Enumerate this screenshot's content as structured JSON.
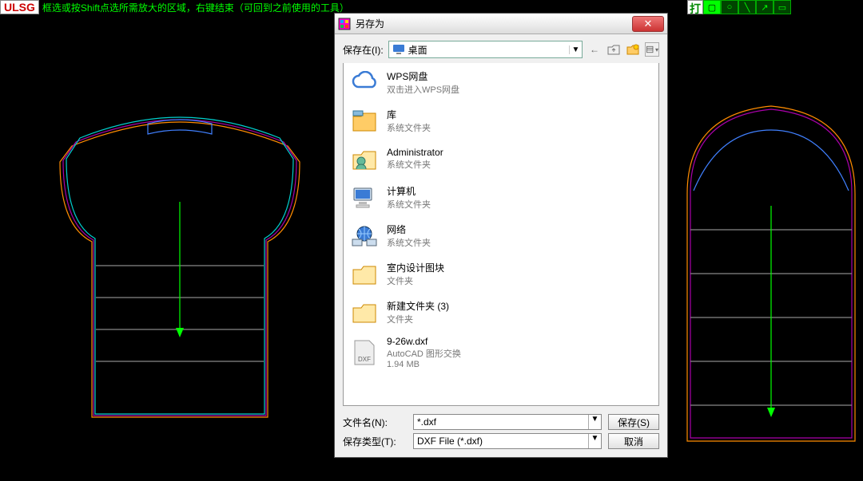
{
  "brand": "ULSG",
  "hint_text": "框选或按Shift点选所需放大的区域，右键结束（可回到之前使用的工具）",
  "tool_label": "打",
  "dialog": {
    "title": "另存为",
    "save_in_label": "保存在(I):",
    "save_in_value": "桌面",
    "items": [
      {
        "name": "WPS网盘",
        "sub": "双击进入WPS网盘",
        "kind": "wps"
      },
      {
        "name": "库",
        "sub": "系统文件夹",
        "kind": "lib"
      },
      {
        "name": "Administrator",
        "sub": "系统文件夹",
        "kind": "user"
      },
      {
        "name": "计算机",
        "sub": "系统文件夹",
        "kind": "computer"
      },
      {
        "name": "网络",
        "sub": "系统文件夹",
        "kind": "network"
      },
      {
        "name": "室内设计图块",
        "sub": "文件夹",
        "kind": "folder"
      },
      {
        "name": "新建文件夹 (3)",
        "sub": "文件夹",
        "kind": "folder"
      },
      {
        "name": "9-26w.dxf",
        "sub": "AutoCAD 图形交换",
        "size": "1.94 MB",
        "kind": "dxf"
      }
    ],
    "filename_label": "文件名(N):",
    "filename_value": "*.dxf",
    "filetype_label": "保存类型(T):",
    "filetype_value": "DXF File (*.dxf)",
    "save_btn": "保存(S)",
    "cancel_btn": "取消"
  }
}
